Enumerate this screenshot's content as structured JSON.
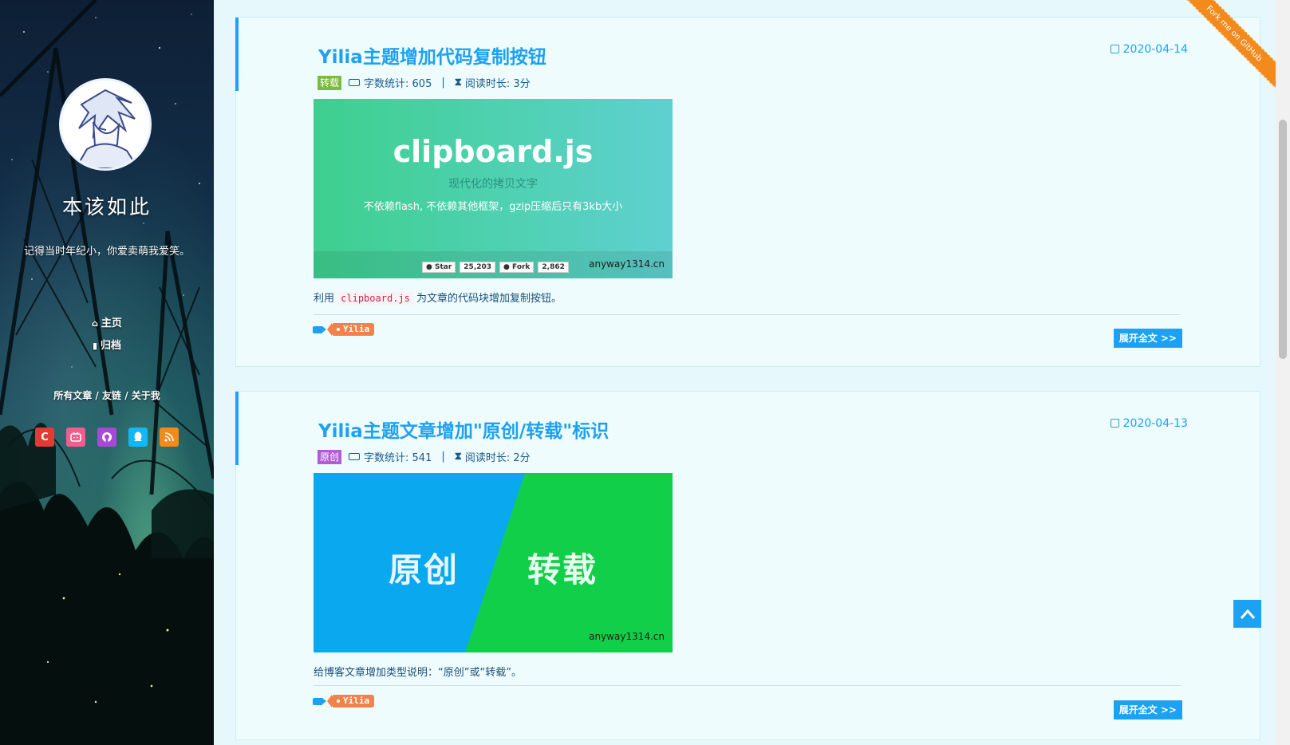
{
  "sidebar": {
    "blog_name": "本该如此",
    "motto": "记得当时年纪小，你爱卖萌我爱笑。",
    "nav": [
      {
        "icon": "home-icon",
        "label": "主页"
      },
      {
        "icon": "archive-icon",
        "label": "归档"
      }
    ],
    "links_line": "所有文章 / 友链 / 关于我",
    "links": [
      "所有文章",
      "友链",
      "关于我"
    ],
    "socials": [
      {
        "name": "csdn-icon",
        "color": "#e53935",
        "glyph": "C"
      },
      {
        "name": "bilibili-icon",
        "color": "#f25d8e",
        "glyph": "▭"
      },
      {
        "name": "github-icon",
        "color": "#a64ad6",
        "glyph": "◉"
      },
      {
        "name": "qq-icon",
        "color": "#12b7f5",
        "glyph": "◆"
      },
      {
        "name": "rss-icon",
        "color": "#f28a1c",
        "glyph": "≀"
      }
    ]
  },
  "posts": [
    {
      "title": "Yilia主题增加代码复制按钮",
      "date": "2020-04-14",
      "badge": "转载",
      "badge_color": "#7cbb3e",
      "word_count": "字数统计: 605",
      "read_time": "阅读时长: 3分",
      "image": {
        "heading": "clipboard.js",
        "sub1": "现代化的拷贝文字",
        "sub2": "不依赖flash, 不依赖其他框架，gzip压缩后只有3kb大小",
        "star_label": "Star",
        "star_count": "25,203",
        "fork_label": "Fork",
        "fork_count": "2,862",
        "watermark": "anyway1314.cn"
      },
      "excerpt_pre": "利用 ",
      "excerpt_code": "clipboard.js",
      "excerpt_post": " 为文章的代码块增加复制按钮。",
      "tag": "Yilia",
      "readmore": "展开全文 >>"
    },
    {
      "title": "Yilia主题文章增加\"原创/转载\"标识",
      "date": "2020-04-13",
      "badge": "原创",
      "badge_color": "#b25ad8",
      "word_count": "字数统计: 541",
      "read_time": "阅读时长: 2分",
      "image": {
        "left_text": "原创",
        "right_text": "转载",
        "watermark": "anyway1314.cn"
      },
      "excerpt": "给博客文章增加类型说明：“原创”或“转载”。",
      "tag": "Yilia",
      "readmore": "展开全文 >>"
    }
  ],
  "ribbon": "Fork me on GitHub",
  "colors": {
    "accent": "#1da1f2",
    "tag": "#f2824a",
    "ribbon": "#f28a1c"
  }
}
